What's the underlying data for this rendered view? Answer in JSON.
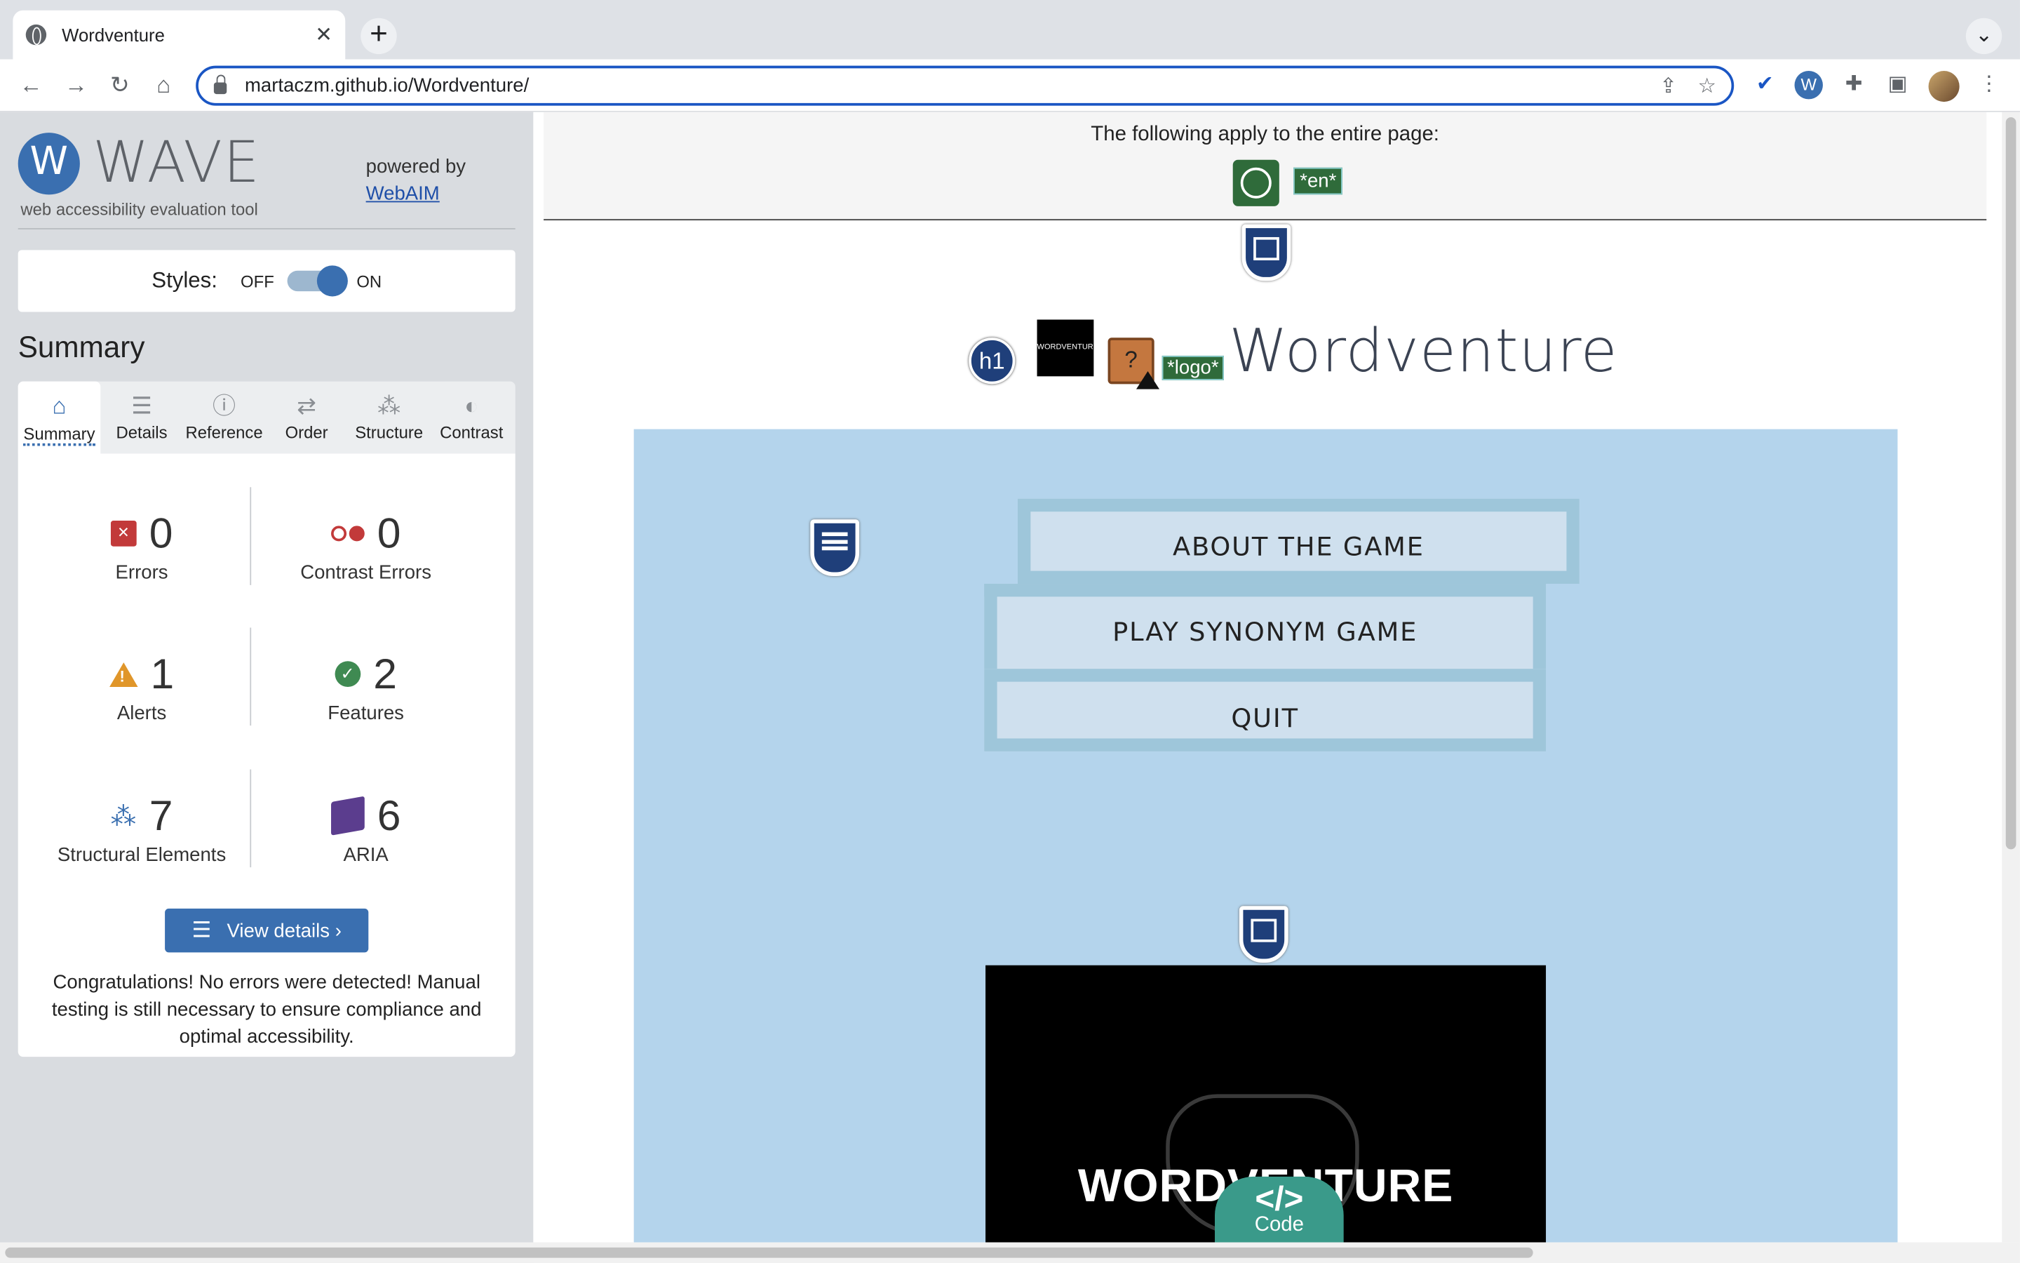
{
  "browser": {
    "tab_title": "Wordventure",
    "tab_close": "✕",
    "new_tab": "+",
    "tab_menu": "⌄",
    "url_host": "martaczm.github.io",
    "url_path": "/Wordventure/"
  },
  "wave": {
    "logo_letter": "W",
    "wordmark": "WAVE",
    "subtitle": "web accessibility evaluation tool",
    "powered_by": "powered by",
    "webaim_link": "WebAIM",
    "styles_label": "Styles:",
    "styles_off": "OFF",
    "styles_on": "ON",
    "summary_heading": "Summary",
    "tabs": [
      {
        "label": "Summary",
        "icon": "home-icon",
        "glyph": "⌂"
      },
      {
        "label": "Details",
        "icon": "list-icon",
        "glyph": "☰"
      },
      {
        "label": "Reference",
        "icon": "info-icon",
        "glyph": "ⓘ"
      },
      {
        "label": "Order",
        "icon": "order-icon",
        "glyph": "⇄"
      },
      {
        "label": "Structure",
        "icon": "structure-icon",
        "glyph": "⁂"
      },
      {
        "label": "Contrast",
        "icon": "contrast-icon",
        "glyph": "◐"
      }
    ],
    "stats": {
      "errors": {
        "count": "0",
        "label": "Errors"
      },
      "contrast_errors": {
        "count": "0",
        "label": "Contrast Errors"
      },
      "alerts": {
        "count": "1",
        "label": "Alerts"
      },
      "features": {
        "count": "2",
        "label": "Features"
      },
      "structural": {
        "count": "7",
        "label": "Structural Elements"
      },
      "aria": {
        "count": "6",
        "label": "ARIA"
      }
    },
    "view_details": "View details ›",
    "congrats": "Congratulations! No errors were detected! Manual testing is still necessary to ensure compliance and optimal accessibility.",
    "colors": {
      "accent": "#3a6fb0",
      "error": "#c23a3a",
      "alert": "#e0962a",
      "feature": "#3f8a52",
      "aria": "#5b3d8e"
    }
  },
  "page": {
    "apply_text": "The following apply to the entire page:",
    "lang_tag": "*en*",
    "h1_tag": "h1",
    "logo_img_text": "WORDVENTURE",
    "alt_tag": "*logo*",
    "img_alert_glyph": "?",
    "site_title": "Wordventure",
    "menu": {
      "about": "ABOUT THE GAME",
      "play": "PLAY SYNONYM GAME",
      "quit": "QUIT"
    },
    "game_title": "WORDVENTURE",
    "code_symbol": "</>",
    "code_label": "Code"
  }
}
